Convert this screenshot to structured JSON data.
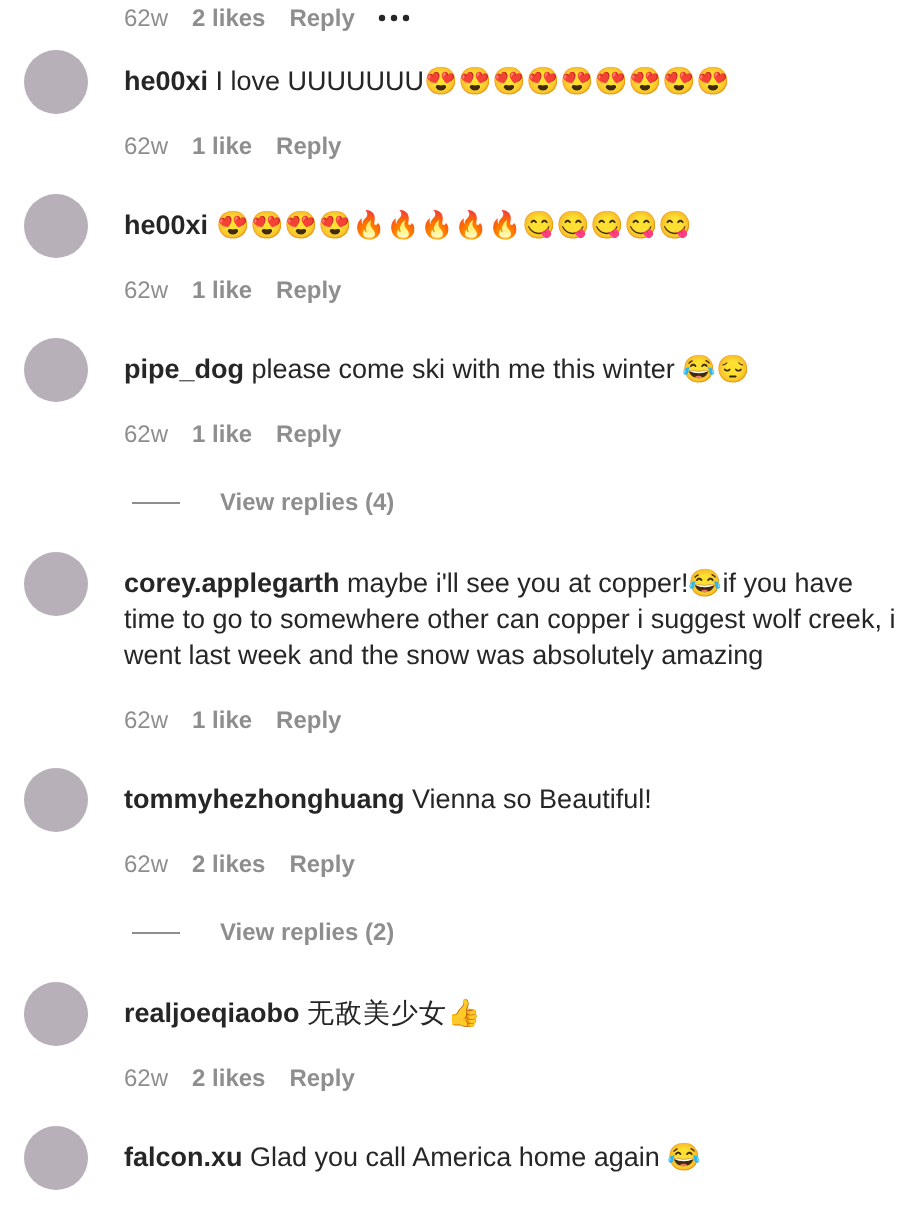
{
  "top_meta": {
    "age": "62w",
    "likes": "2 likes",
    "reply": "Reply"
  },
  "comments": [
    {
      "username": "he00xi",
      "text": "I love UUUUUUU😍😍😍😍😍😍😍😍😍",
      "age": "62w",
      "likes": "1 like",
      "reply": "Reply"
    },
    {
      "username": "he00xi",
      "text": "😍😍😍😍🔥🔥🔥🔥🔥😋😋😋😋😋",
      "age": "62w",
      "likes": "1 like",
      "reply": "Reply"
    },
    {
      "username": "pipe_dog",
      "text": "please come ski with me this winter 😂😔",
      "age": "62w",
      "likes": "1 like",
      "reply": "Reply",
      "view_replies": "View replies (4)"
    },
    {
      "username": "corey.applegarth",
      "text": "maybe i'll see you at copper!😂if you have time to go to somewhere other can copper i suggest wolf creek, i went last week and the snow was absolutely amazing",
      "age": "62w",
      "likes": "1 like",
      "reply": "Reply"
    },
    {
      "username": "tommyhezhonghuang",
      "text": "Vienna so Beautiful!",
      "age": "62w",
      "likes": "2 likes",
      "reply": "Reply",
      "view_replies": "View replies (2)"
    },
    {
      "username": "realjoeqiaobo",
      "text": "无敌美少女👍",
      "age": "62w",
      "likes": "2 likes",
      "reply": "Reply"
    },
    {
      "username": "falcon.xu",
      "text": "Glad you call America home again 😂"
    }
  ]
}
